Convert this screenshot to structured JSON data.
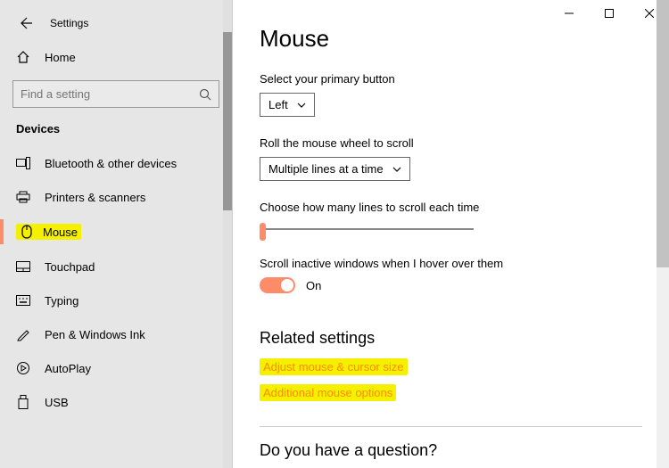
{
  "window": {
    "app_title": "Settings"
  },
  "sidebar": {
    "home_label": "Home",
    "search_placeholder": "Find a setting",
    "section_label": "Devices",
    "items": [
      {
        "label": "Bluetooth & other devices"
      },
      {
        "label": "Printers & scanners"
      },
      {
        "label": "Mouse"
      },
      {
        "label": "Touchpad"
      },
      {
        "label": "Typing"
      },
      {
        "label": "Pen & Windows Ink"
      },
      {
        "label": "AutoPlay"
      },
      {
        "label": "USB"
      }
    ]
  },
  "main": {
    "heading": "Mouse",
    "primary_button": {
      "label": "Select your primary button",
      "value": "Left"
    },
    "wheel_scroll": {
      "label": "Roll the mouse wheel to scroll",
      "value": "Multiple lines at a time"
    },
    "lines_label": "Choose how many lines to scroll each time",
    "inactive": {
      "label": "Scroll inactive windows when I hover over them",
      "state": "On"
    },
    "related": {
      "heading": "Related settings",
      "links": [
        "Adjust mouse & cursor size",
        "Additional mouse options"
      ]
    },
    "question_heading": "Do you have a question?"
  }
}
